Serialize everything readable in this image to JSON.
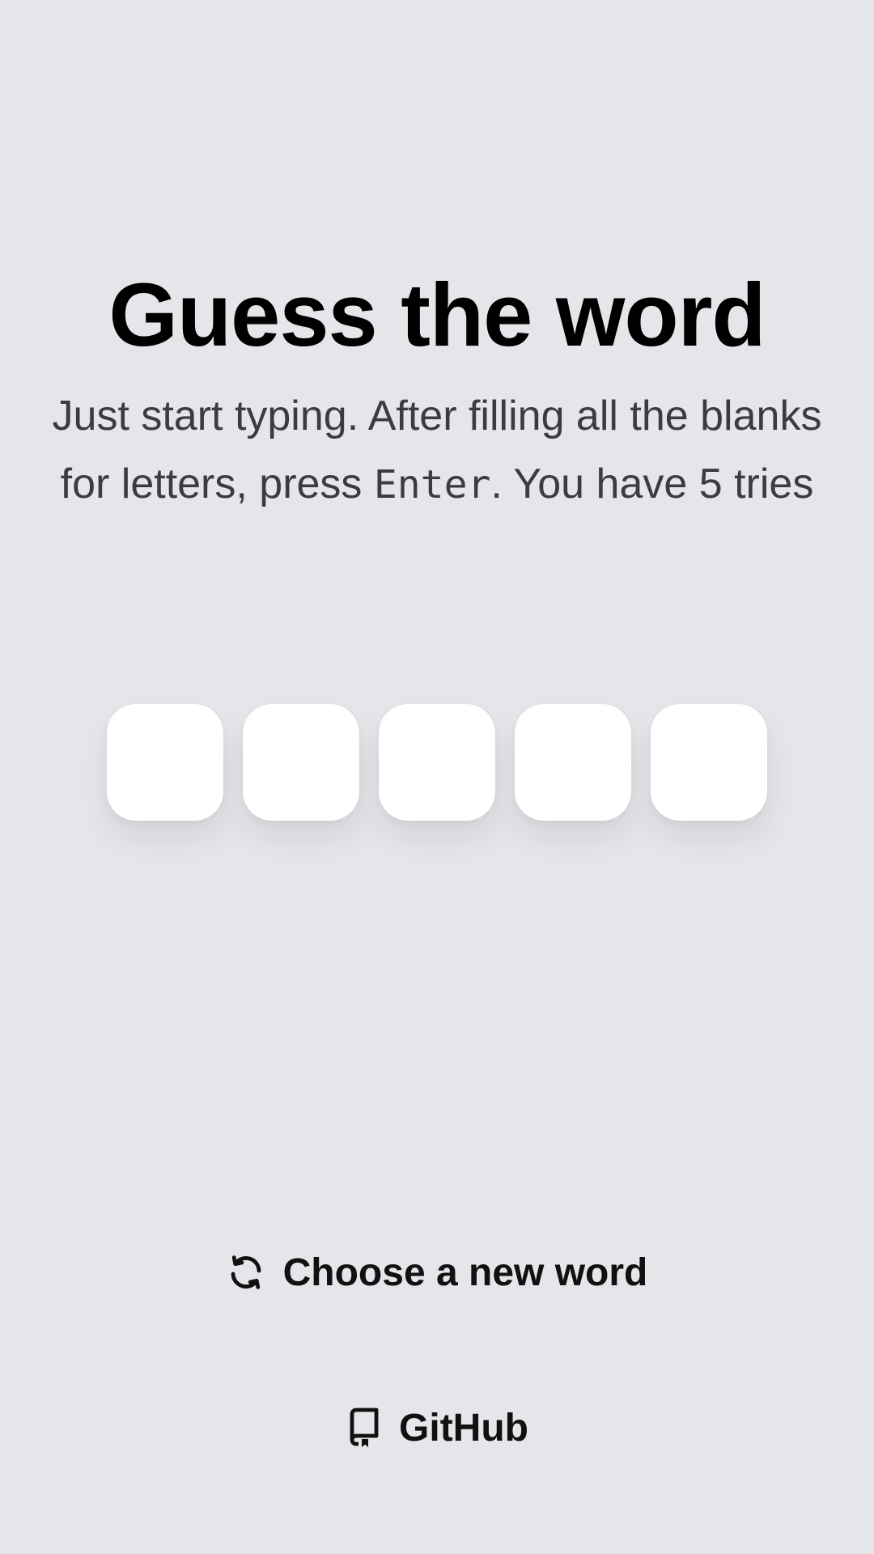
{
  "header": {
    "title": "Guess the word",
    "instructions_before": "Just start typing. After filling all the blanks for letters, press ",
    "instructions_key": "Enter",
    "instructions_after": ". You have 5 tries"
  },
  "board": {
    "tiles": [
      "",
      "",
      "",
      "",
      ""
    ]
  },
  "actions": {
    "new_word_label": "Choose a new word",
    "new_word_icon": "refresh-icon",
    "github_label": "GitHub",
    "github_icon": "repo-icon"
  },
  "colors": {
    "background": "#e5e6ea",
    "tile": "#ffffff",
    "text": "#000000"
  }
}
